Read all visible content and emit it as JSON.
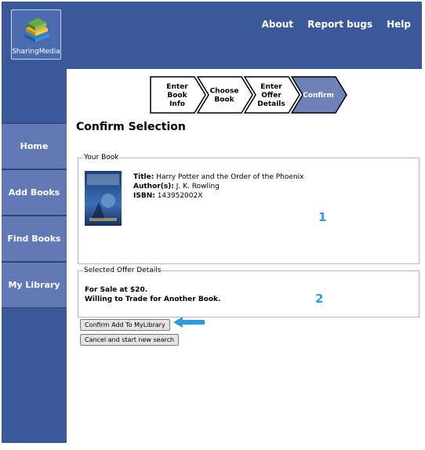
{
  "logo": {
    "text": "SharingMedia",
    "icon": "stacked-books-icon"
  },
  "topnav": {
    "about": "About",
    "report_bugs": "Report bugs",
    "help": "Help"
  },
  "sidebar": {
    "items": [
      {
        "label": "Home"
      },
      {
        "label": "Add Books"
      },
      {
        "label": "Find Books"
      },
      {
        "label": "My Library"
      }
    ]
  },
  "steps": [
    {
      "lines": [
        "Enter",
        "Book",
        "Info"
      ],
      "active": false
    },
    {
      "lines": [
        "Choose",
        "Book"
      ],
      "active": false
    },
    {
      "lines": [
        "Enter",
        "Offer",
        "Details"
      ],
      "active": false
    },
    {
      "lines": [
        "Confirm"
      ],
      "active": true
    }
  ],
  "page_title": "Confirm Selection",
  "your_book": {
    "legend": "Your Book",
    "title_label": "Title:",
    "title": "Harry Potter and the Order of the Phoenix",
    "author_label": "Author(s):",
    "author": "J. K. Rowling",
    "isbn_label": "ISBN:",
    "isbn": "143952002X",
    "marker": "1"
  },
  "offer": {
    "legend": "Selected Offer Details",
    "line1": "For Sale at $20.",
    "line2": "Willing to Trade for Another Book.",
    "marker": "2"
  },
  "buttons": {
    "confirm": "Confirm Add To MyLibrary",
    "cancel": "Cancel and start new search"
  },
  "colors": {
    "frame": "#3b5998",
    "sidebar_item": "#6379b5",
    "step_active": "#6f82b8",
    "marker": "#2e9be0"
  }
}
